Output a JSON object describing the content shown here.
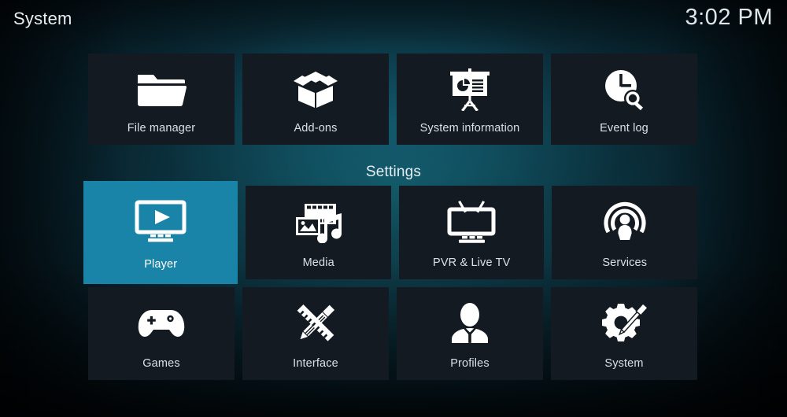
{
  "header": {
    "title": "System",
    "clock": "3:02 PM"
  },
  "sections": {
    "settings_heading": "Settings"
  },
  "colors": {
    "tile_background": "#131a21",
    "tile_focused_background": "#1a84a8",
    "icon_color": "#ffffff",
    "label_color": "#d9e1e6",
    "background_teal": "#11535f"
  },
  "top_row": {
    "name": "utilities-row",
    "tiles": [
      {
        "label": "File manager",
        "icon": "folder-icon",
        "focused": false
      },
      {
        "label": "Add-ons",
        "icon": "open-box-icon",
        "focused": false
      },
      {
        "label": "System information",
        "icon": "presentation-board-icon",
        "focused": false
      },
      {
        "label": "Event log",
        "icon": "clock-search-icon",
        "focused": false
      }
    ]
  },
  "settings_row_1": {
    "name": "settings-row-one",
    "tiles": [
      {
        "label": "Player",
        "icon": "monitor-play-icon",
        "focused": true
      },
      {
        "label": "Media",
        "icon": "media-mixed-icon",
        "focused": false
      },
      {
        "label": "PVR & Live TV",
        "icon": "tv-antenna-icon",
        "focused": false
      },
      {
        "label": "Services",
        "icon": "broadcast-user-icon",
        "focused": false
      }
    ]
  },
  "settings_row_2": {
    "name": "settings-row-two",
    "tiles": [
      {
        "label": "Games",
        "icon": "gamepad-icon",
        "focused": false
      },
      {
        "label": "Interface",
        "icon": "pencil-ruler-icon",
        "focused": false
      },
      {
        "label": "Profiles",
        "icon": "user-bust-icon",
        "focused": false
      },
      {
        "label": "System",
        "icon": "gear-screwdriver-icon",
        "focused": false
      }
    ]
  }
}
